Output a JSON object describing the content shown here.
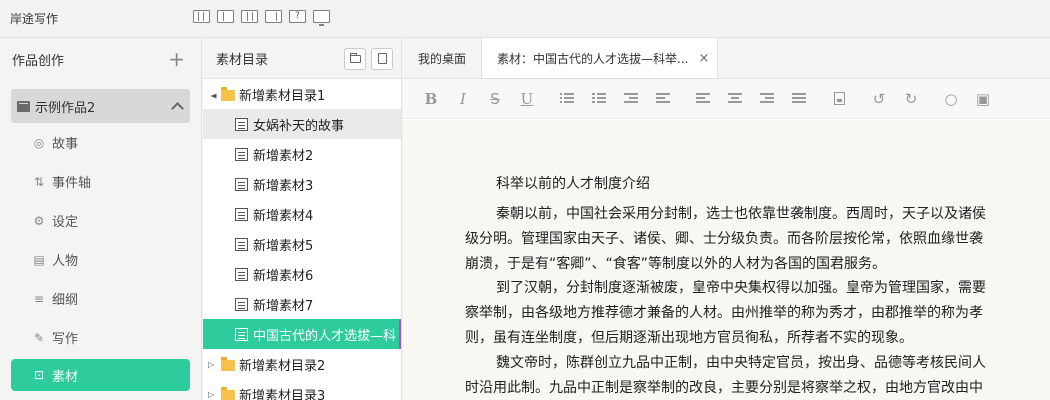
{
  "app": {
    "title": "岸途写作"
  },
  "sidebar": {
    "header": "作品创作",
    "add": "+",
    "project": "示例作品2",
    "items": [
      {
        "label": "故事",
        "icon": "life-ring-icon",
        "glyph": "◎"
      },
      {
        "label": "事件轴",
        "icon": "sort-icon",
        "glyph": "⇅"
      },
      {
        "label": "设定",
        "icon": "gears-icon",
        "glyph": "⚙"
      },
      {
        "label": "人物",
        "icon": "id-card-icon",
        "glyph": "▤"
      },
      {
        "label": "细纲",
        "icon": "list-icon",
        "glyph": "≡"
      },
      {
        "label": "写作",
        "icon": "pencil-icon",
        "glyph": "✎"
      },
      {
        "label": "素材",
        "icon": "image-icon",
        "glyph": "⊡"
      }
    ]
  },
  "tree": {
    "header": "素材目录",
    "rows": [
      {
        "type": "folder",
        "label": "新增素材目录1",
        "caret": "▲"
      },
      {
        "type": "file",
        "label": "女娲补天的故事"
      },
      {
        "type": "file",
        "label": "新增素材2"
      },
      {
        "type": "file",
        "label": "新增素材3"
      },
      {
        "type": "file",
        "label": "新增素材4"
      },
      {
        "type": "file",
        "label": "新增素材5"
      },
      {
        "type": "file",
        "label": "新增素材6"
      },
      {
        "type": "file",
        "label": "新增素材7"
      },
      {
        "type": "file",
        "label": "中国古代的人才选拔—科"
      },
      {
        "type": "folder",
        "label": "新增素材目录2",
        "caret": "▷"
      },
      {
        "type": "folder",
        "label": "新增素材目录3",
        "caret": "▷"
      }
    ]
  },
  "tabs": [
    {
      "label": "我的桌面"
    },
    {
      "label": "素材：中国古代的人才选拔—科举...",
      "close": "×"
    }
  ],
  "toolbar": {
    "bold": "B",
    "italic": "I",
    "strike": "S",
    "underline": "U",
    "undo": "↺",
    "redo": "↻",
    "circle": "○",
    "save": "▣"
  },
  "document": {
    "title": "科举以前的人才制度介绍",
    "paragraphs": [
      [
        "秦朝以前，中国社会采用分封制，选士也依靠世袭制度。西周时，天子以及诸侯",
        "级分明。管理国家由天子、诸侯、卿、士分级负责。而各阶层按伦常，依照血缘世袭",
        "崩溃，于是有“客卿”、“食客”等制度以外的人材为各国的国君服务。"
      ],
      [
        "到了汉朝，分封制度逐渐被废，皇帝中央集权得以加强。皇帝为管理国家，需要",
        "察举制，由各级地方推荐德才兼备的人材。由州推举的称为秀才，由郡推举的称为孝",
        "则，虽有连坐制度，但后期逐渐出现地方官员徇私，所荐者不实的现象。"
      ],
      [
        "魏文帝时，陈群创立九品中正制，由中央特定官员，按出身、品德等考核民间人",
        "时沿用此制。九品中正制是察举制的改良，主要分别是将察举之权，由地方官改由中"
      ]
    ]
  }
}
